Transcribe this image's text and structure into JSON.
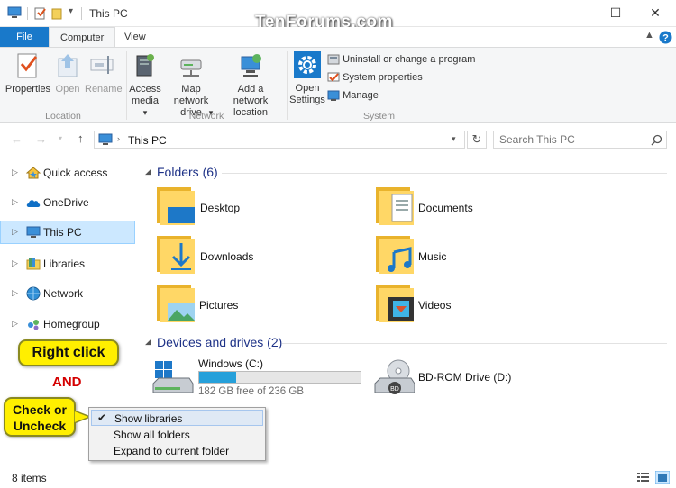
{
  "window": {
    "title": "This PC",
    "watermark": "TenForums.com",
    "controls": {
      "minimize": "—",
      "maximize": "☐",
      "close": "✕"
    }
  },
  "ribbon": {
    "tabs": [
      "File",
      "Computer",
      "View"
    ],
    "active_tab": "Computer",
    "groups": {
      "location": {
        "label": "Location",
        "properties": "Properties",
        "open": "Open",
        "rename": "Rename"
      },
      "network": {
        "label": "Network",
        "access_media": "Access media",
        "map_drive": "Map network drive",
        "add_location": "Add a network location"
      },
      "system": {
        "label": "System",
        "open_settings": "Open Settings",
        "uninstall": "Uninstall or change a program",
        "system_properties": "System properties",
        "manage": "Manage"
      }
    }
  },
  "address": {
    "path": "This PC",
    "search_placeholder": "Search This PC"
  },
  "nav": {
    "items": [
      {
        "label": "Quick access",
        "icon": "star-icon"
      },
      {
        "label": "OneDrive",
        "icon": "cloud-icon"
      },
      {
        "label": "This PC",
        "icon": "computer-icon",
        "selected": true
      },
      {
        "label": "Libraries",
        "icon": "library-icon"
      },
      {
        "label": "Network",
        "icon": "network-icon"
      },
      {
        "label": "Homegroup",
        "icon": "homegroup-icon"
      }
    ]
  },
  "content": {
    "folders_title": "Folders (6)",
    "folders": [
      "Desktop",
      "Documents",
      "Downloads",
      "Music",
      "Pictures",
      "Videos"
    ],
    "drives_title": "Devices and drives (2)",
    "drives": [
      {
        "name": "Windows (C:)",
        "free": "182 GB free of 236 GB",
        "used_fraction": 0.229
      },
      {
        "name": "BD-ROM Drive (D:)"
      }
    ]
  },
  "annotations": {
    "right_click": "Right click",
    "and": "AND",
    "check_line1": "Check or",
    "check_line2": "Uncheck"
  },
  "context_menu": {
    "items": [
      {
        "label": "Show libraries",
        "checked": true
      },
      {
        "label": "Show all folders",
        "checked": false
      },
      {
        "label": "Expand to current folder",
        "checked": false
      }
    ]
  },
  "status": {
    "count": "8 items"
  },
  "colors": {
    "accent": "#1979ca",
    "selected": "#cce8ff",
    "folder": "#f8c43c",
    "section_title": "#1e3287",
    "callout": "#ffef00",
    "and_red": "#d40000",
    "drive_bar": "#26a0da"
  }
}
